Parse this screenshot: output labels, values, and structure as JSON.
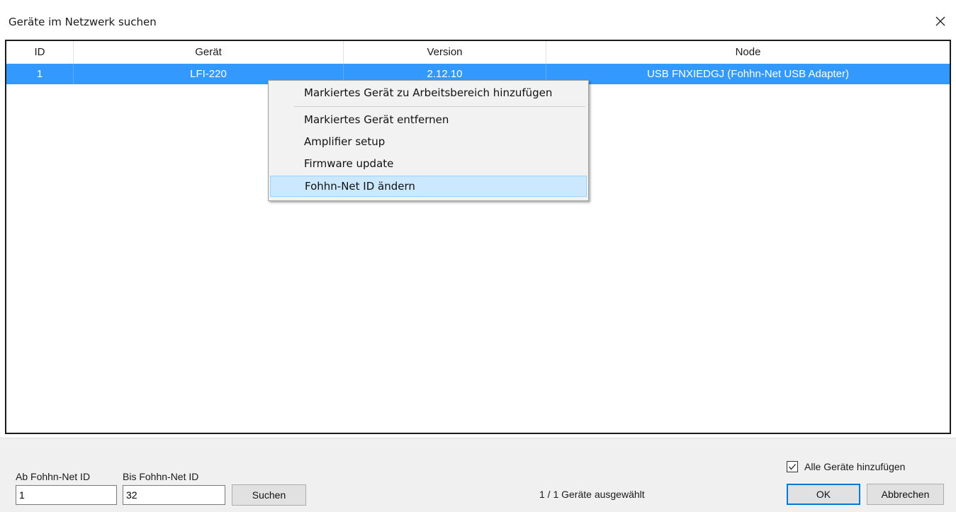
{
  "window": {
    "title": "Geräte im Netzwerk suchen",
    "close_icon": "close-icon"
  },
  "table": {
    "columns": [
      "ID",
      "Gerät",
      "Version",
      "Node"
    ],
    "rows": [
      {
        "id": "1",
        "device": "LFI-220",
        "version": "2.12.10",
        "node": "USB FNXIEDGJ (Fohhn-Net USB Adapter)",
        "selected": true
      }
    ],
    "selection_color": "#3399ff"
  },
  "context_menu": {
    "items": [
      "Markiertes Gerät zu Arbeitsbereich hinzufügen",
      "Markiertes Gerät entfernen",
      "Amplifier setup",
      "Firmware update",
      "Fohhn-Net ID ändern"
    ],
    "highlighted": "Fohhn-Net ID ändern"
  },
  "footer": {
    "from_label": "Ab Fohhn-Net ID",
    "from_value": "1",
    "to_label": "Bis Fohhn-Net ID",
    "to_value": "32",
    "search_label": "Suchen",
    "status": "1 / 1 Geräte ausgewählt",
    "add_all_label": "Alle Geräte hinzufügen",
    "add_all_checked": true,
    "ok_label": "OK",
    "cancel_label": "Abbrechen"
  }
}
